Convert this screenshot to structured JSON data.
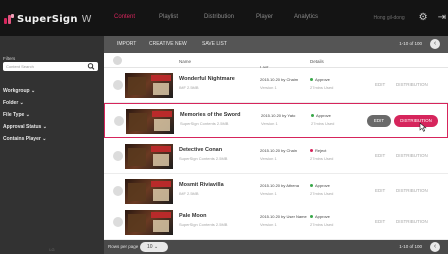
{
  "app": {
    "brand": "SuperSign",
    "brand_suffix": "W",
    "accent_color": "#d6255c"
  },
  "nav": {
    "tabs": [
      "Content",
      "Playlist",
      "Distribution",
      "Player",
      "Analytics"
    ],
    "active_tab": "Content",
    "user_name": "Hong gil-dong",
    "settings_icon": "gear-icon",
    "logout_icon": "exit-icon"
  },
  "sidebar": {
    "filters_label": "Filters",
    "search_placeholder": "Content Search",
    "search_icon": "search-icon",
    "items": [
      "Workgroup",
      "Folder",
      "File Type",
      "Approval Status",
      "Contains Player"
    ],
    "footer": "LG"
  },
  "toolbar": {
    "import_label": "IMPORT",
    "create_label": "CREATIVE NEW",
    "save_list_label": "SAVE LIST",
    "pager": "1-10 of 100"
  },
  "table": {
    "headers": {
      "name": "Name",
      "last_updated": "Last Updated",
      "details": "Details"
    },
    "rows": [
      {
        "name": "Wonderful Nightmare",
        "sub": "IMF   2.5MB",
        "date": "2015.10.20  by Chaim",
        "version": "Version 1",
        "status": "Approve",
        "status_color": "#3aa84a",
        "status_sub": "27mins Used",
        "edit": "EDIT",
        "dist": "DISTRIBUTION",
        "selected": false
      },
      {
        "name": "Memories of the Sword",
        "sub": "SuperSign Contents   2.5MB",
        "date": "2015.10.20  by Yato",
        "version": "Version 1",
        "status": "Approve",
        "status_color": "#3aa84a",
        "status_sub": "27mins Used",
        "edit": "EDIT",
        "dist": "DISTRIBUTION",
        "selected": true
      },
      {
        "name": "Detective Conan",
        "sub": "SuperSign Contents   2.5MB",
        "date": "2015.10.20  by Chain",
        "version": "Version 1",
        "status": "Reject",
        "status_color": "#d6255c",
        "status_sub": "27mins Used",
        "edit": "EDIT",
        "dist": "DISTRIBUTION",
        "selected": false
      },
      {
        "name": "Mosmit Riviavilla",
        "sub": "IMF   2.5MB",
        "date": "2015.10.20  by Athena",
        "version": "Version 1",
        "status": "Approve",
        "status_color": "#3aa84a",
        "status_sub": "27mins Used",
        "edit": "EDIT",
        "dist": "DISTRIBUTION",
        "selected": false
      },
      {
        "name": "Pale Moon",
        "sub": "SuperSign Contents   2.5MB",
        "date": "2015.10.20  by User Name",
        "version": "Version 1",
        "status": "Approve",
        "status_color": "#3aa84a",
        "status_sub": "27mins Used",
        "edit": "EDIT",
        "dist": "DISTRIBUTION",
        "selected": false
      }
    ]
  },
  "footer": {
    "rows_per_page_label": "Rows per page",
    "rows_per_page_value": "10",
    "pager": "1-10 of 100"
  }
}
